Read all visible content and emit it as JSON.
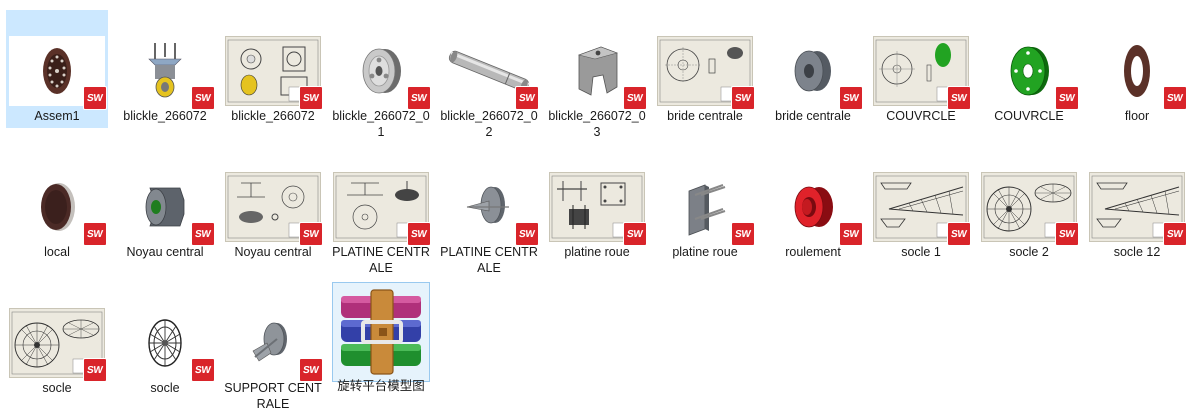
{
  "files": [
    {
      "name": "Assem1",
      "kind": "assembly",
      "thumb": "disc-brown"
    },
    {
      "name": "blickle_266072",
      "kind": "part",
      "thumb": "caster-yellow"
    },
    {
      "name": "blickle_266072",
      "kind": "drawing",
      "thumb": "drawing-caster"
    },
    {
      "name": "blickle_266072_01",
      "kind": "part",
      "thumb": "wheel-gray"
    },
    {
      "name": "blickle_266072_02",
      "kind": "part",
      "thumb": "axle-gray"
    },
    {
      "name": "blickle_266072_03",
      "kind": "part",
      "thumb": "bracket-gray"
    },
    {
      "name": "bride centrale",
      "kind": "drawing",
      "thumb": "drawing-flange"
    },
    {
      "name": "bride centrale",
      "kind": "part",
      "thumb": "pulley-gray"
    },
    {
      "name": "COUVRCLE",
      "kind": "drawing",
      "thumb": "drawing-green"
    },
    {
      "name": "COUVRCLE",
      "kind": "part",
      "thumb": "disc-green"
    },
    {
      "name": "floor",
      "kind": "part",
      "thumb": "ring-brown"
    },
    {
      "name": "local",
      "kind": "part",
      "thumb": "disc-brown-dark"
    },
    {
      "name": "Noyau central",
      "kind": "part",
      "thumb": "hub-green"
    },
    {
      "name": "Noyau central",
      "kind": "drawing",
      "thumb": "drawing-hub"
    },
    {
      "name": "PLATINE CENTRALE",
      "kind": "drawing",
      "thumb": "drawing-platine"
    },
    {
      "name": "PLATINE CENTRALE",
      "kind": "part",
      "thumb": "platine-gray"
    },
    {
      "name": "platine roue",
      "kind": "drawing",
      "thumb": "drawing-plate"
    },
    {
      "name": "platine roue",
      "kind": "part",
      "thumb": "plate-gray"
    },
    {
      "name": "roulement",
      "kind": "part",
      "thumb": "bearing-red"
    },
    {
      "name": "socle 1",
      "kind": "drawing",
      "thumb": "drawing-socle"
    },
    {
      "name": "socle 2",
      "kind": "drawing",
      "thumb": "drawing-wheel"
    },
    {
      "name": "socle 12",
      "kind": "drawing",
      "thumb": "drawing-socle"
    },
    {
      "name": "socle",
      "kind": "drawing",
      "thumb": "drawing-wheel"
    },
    {
      "name": "socle",
      "kind": "part",
      "thumb": "spoke-wheel"
    },
    {
      "name": "SUPPORT CENTRALE",
      "kind": "part",
      "thumb": "support-gray"
    },
    {
      "name": "旋转平台模型图",
      "kind": "archive",
      "thumb": "winrar-icon"
    }
  ],
  "badge_text": "SW",
  "colors": {
    "selection": "#cce8ff",
    "badge": "#d9242a"
  }
}
